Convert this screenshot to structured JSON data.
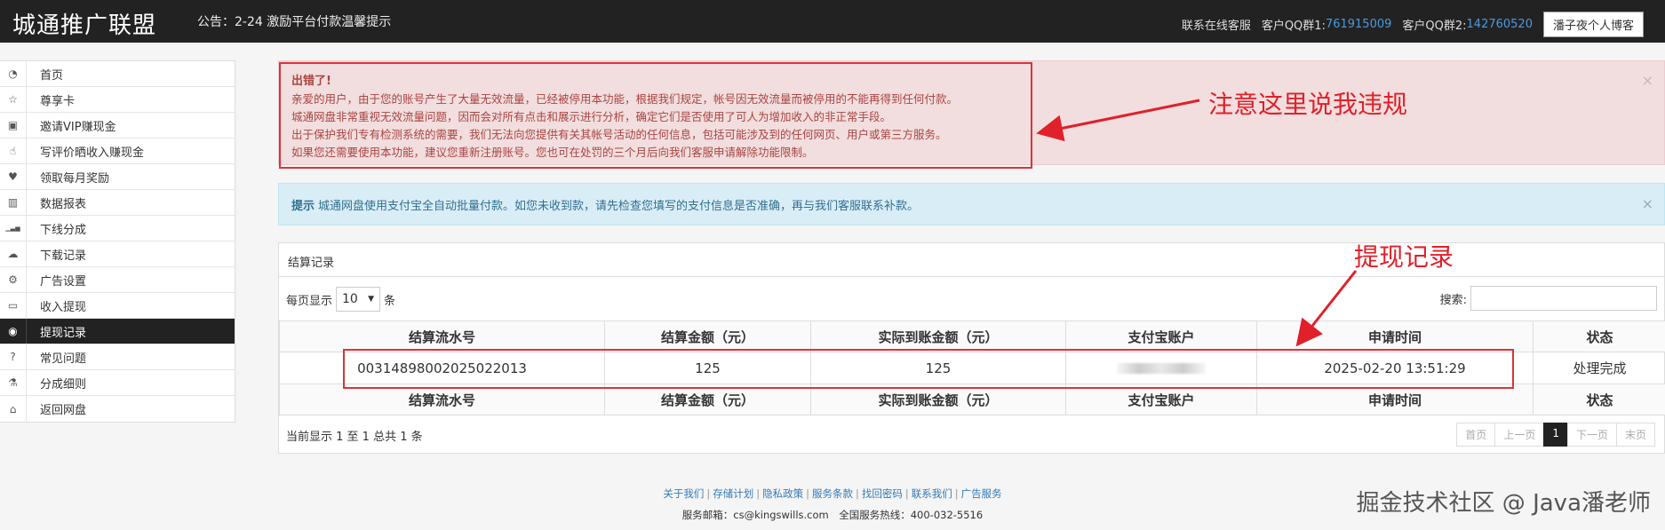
{
  "header": {
    "brand": "城通推广联盟",
    "notice": "公告：2-24 激励平台付款温馨提示",
    "support": "联系在线客服",
    "qq1_label": "客户QQ群1:",
    "qq1": "761915009",
    "qq2_label": "客户QQ群2:",
    "qq2": "142760520",
    "user_button": "潘子夜个人博客"
  },
  "sidebar": {
    "items": [
      {
        "label": "首页",
        "icon": "dashboard-icon"
      },
      {
        "label": "尊享卡",
        "icon": "star-icon"
      },
      {
        "label": "邀请VIP赚现金",
        "icon": "gift-icon"
      },
      {
        "label": "写评价晒收入赚现金",
        "icon": "thumbs-up-icon"
      },
      {
        "label": "领取每月奖励",
        "icon": "heart-icon"
      },
      {
        "label": "数据报表",
        "icon": "bar-chart-icon"
      },
      {
        "label": "下线分成",
        "icon": "signal-icon"
      },
      {
        "label": "下载记录",
        "icon": "cloud-download-icon"
      },
      {
        "label": "广告设置",
        "icon": "gear-icon"
      },
      {
        "label": "收入提现",
        "icon": "credit-card-icon"
      },
      {
        "label": "提现记录",
        "icon": "money-icon"
      },
      {
        "label": "常见问题",
        "icon": "question-icon"
      },
      {
        "label": "分成细则",
        "icon": "flask-icon"
      },
      {
        "label": "返回网盘",
        "icon": "home-icon"
      }
    ],
    "active_index": 10
  },
  "alert_danger": {
    "title": "出错了!",
    "lines": [
      "亲爱的用户，由于您的账号产生了大量无效流量，已经被停用本功能，根据我们规定，帐号因无效流量而被停用的不能再得到任何付款。",
      "城通网盘非常重视无效流量问题，因而会对所有点击和展示进行分析，确定它们是否使用了可人为增加收入的非正常手段。",
      "出于保护我们专有检测系统的需要，我们无法向您提供有关其帐号活动的任何信息，包括可能涉及到的任何网页、用户或第三方服务。",
      "如果您还需要使用本功能，建议您重新注册账号。您也可在处罚的三个月后向我们客服申请解除功能限制。"
    ],
    "close": "×"
  },
  "alert_info": {
    "strong": "提示",
    "text": "城通网盘使用支付宝全自动批量付款。如您未收到款，请先检查您填写的支付信息是否准确，再与我们客服联系补款。",
    "close": "×"
  },
  "panel": {
    "title": "结算记录",
    "length_prefix": "每页显示",
    "length_value": "10",
    "length_suffix": "条",
    "search_label": "搜索:",
    "columns": [
      "结算流水号",
      "结算金额（元）",
      "实际到账金额（元）",
      "支付宝账户",
      "申请时间",
      "状态"
    ],
    "rows": [
      {
        "serial": "00314898002025022013",
        "amount": "125",
        "received": "125",
        "account": "",
        "time": "2025-02-20 13:51:29",
        "status": "处理完成"
      }
    ],
    "info": "当前显示 1 至 1 总共 1 条",
    "pager": [
      "首页",
      "上一页",
      "1",
      "下一页",
      "末页"
    ]
  },
  "annotations": {
    "violation": "注意这里说我违规",
    "record": "提现记录",
    "color": "#e0202a"
  },
  "footer": {
    "links": [
      "关于我们",
      "存储计划",
      "隐私政策",
      "服务条款",
      "找回密码",
      "联系我们",
      "广告服务"
    ],
    "contact": "服务邮箱：cs@kingswills.com　全国服务热线：400-032-5516"
  },
  "watermark": "掘金技术社区 @ Java潘老师"
}
